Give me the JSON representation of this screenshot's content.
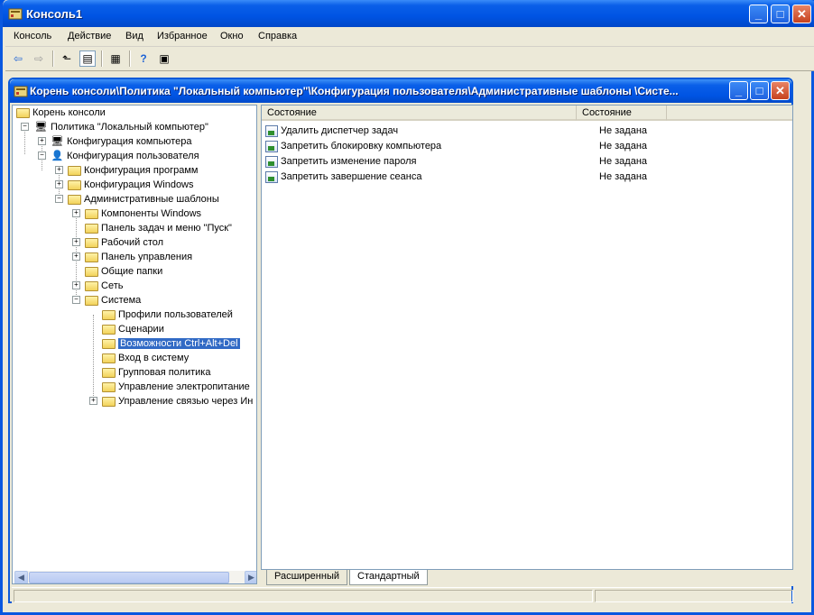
{
  "window": {
    "title": "Консоль1",
    "minimize": "_",
    "maximize": "□",
    "close": "✕"
  },
  "menu": [
    "Консоль",
    "Действие",
    "Вид",
    "Избранное",
    "Окно",
    "Справка"
  ],
  "toolbar": {
    "back": "⇦",
    "forward": "⇨",
    "up": "⬑",
    "show_tree": "▤",
    "export": "▦",
    "help": "?",
    "action_pane": "▣"
  },
  "child_window": {
    "title": "Корень консоли\\Политика \"Локальный компьютер\"\\Конфигурация пользователя\\Административные шаблоны \\Систе...",
    "minimize": "_",
    "maximize": "□",
    "close": "✕"
  },
  "tree": {
    "root": "Корень консоли",
    "policy": "Политика \"Локальный компьютер\"",
    "computer_config": "Конфигурация компьютера",
    "user_config": "Конфигурация пользователя",
    "software": "Конфигурация программ",
    "windows": "Конфигурация Windows",
    "admin_templates": "Административные шаблоны",
    "windows_components": "Компоненты Windows",
    "taskbar": "Панель задач и меню \"Пуск\"",
    "desktop": "Рабочий стол",
    "control_panel": "Панель управления",
    "shared_folders": "Общие папки",
    "network": "Сеть",
    "system": "Система",
    "user_profiles": "Профили пользователей",
    "scripts": "Сценарии",
    "ctrl_alt_del": "Возможности Ctrl+Alt+Del",
    "logon": "Вход в систему",
    "group_policy": "Групповая политика",
    "power": "Управление электропитание",
    "internet_comm": "Управление связью через Ин"
  },
  "list": {
    "columns": [
      "Состояние",
      "Состояние",
      ""
    ],
    "rows": [
      {
        "name": "Удалить диспетчер задач",
        "state": "Не задана"
      },
      {
        "name": "Запретить блокировку компьютера",
        "state": "Не задана"
      },
      {
        "name": "Запретить изменение пароля",
        "state": "Не задана"
      },
      {
        "name": "Запретить завершение сеанса",
        "state": "Не задана"
      }
    ]
  },
  "tabs": [
    "Расширенный",
    "Стандартный"
  ],
  "colors": {
    "titlebar": "#0054e3",
    "selection": "#316ac5",
    "face": "#ece9d8"
  }
}
